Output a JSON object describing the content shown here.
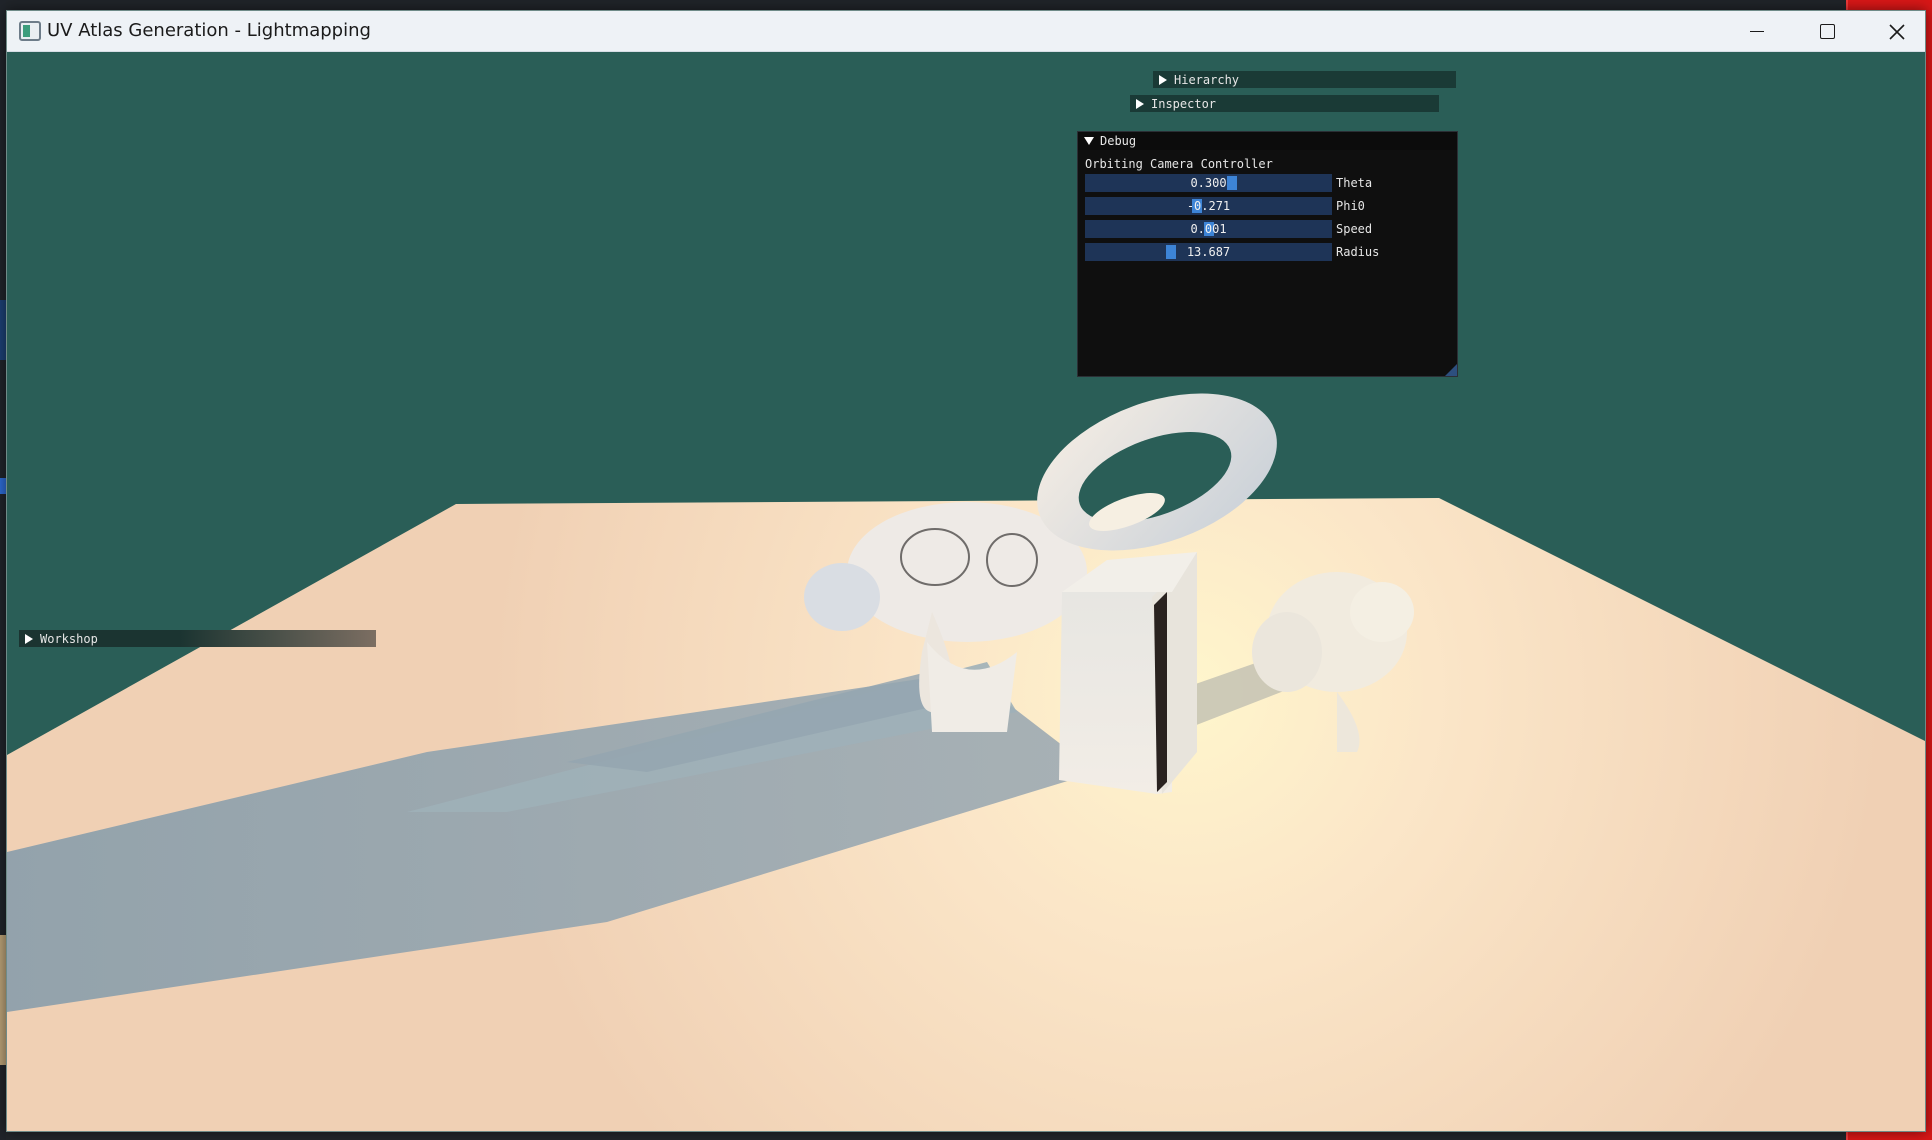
{
  "window": {
    "title": "UV Atlas Generation - Lightmapping"
  },
  "panels": {
    "hierarchy": {
      "label": "Hierarchy"
    },
    "inspector": {
      "label": "Inspector"
    },
    "workshop": {
      "label": "Workshop"
    },
    "debug": {
      "label": "Debug",
      "section": "Orbiting Camera Controller",
      "sliders": [
        {
          "label": "Theta",
          "value": "0.300",
          "fraction": 0.6
        },
        {
          "label": "Phi0",
          "value": "-0.271",
          "fraction": 0.45
        },
        {
          "label": "Speed",
          "value": "0.001",
          "fraction": 0.5
        },
        {
          "label": "Radius",
          "value": "13.687",
          "fraction": 0.34
        }
      ]
    }
  },
  "colors": {
    "background": "#2a5e57",
    "floor": "#f3d8be",
    "slider_frame": "#1e3457",
    "slider_grab": "#3d84d6",
    "panel_header": "#1a3a36"
  }
}
